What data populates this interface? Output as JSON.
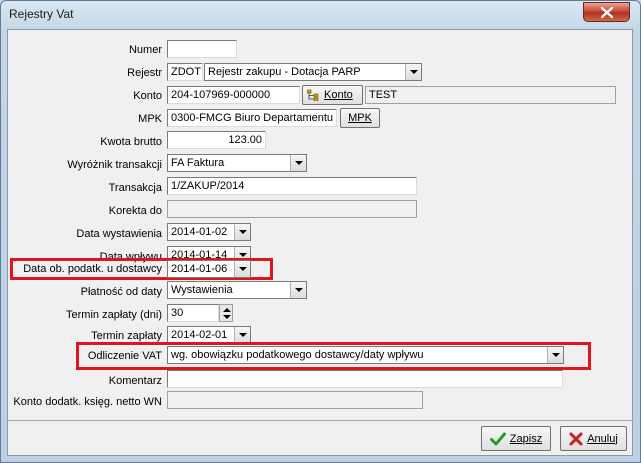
{
  "window": {
    "title": "Rejestry Vat"
  },
  "form": {
    "numer": {
      "label": "Numer",
      "value": ""
    },
    "rejestr": {
      "label": "Rejestr",
      "code": "ZDOT",
      "value": "Rejestr zakupu - Dotacja PARP"
    },
    "konto": {
      "label": "Konto",
      "value": "204-107969-000000",
      "button": "Konto",
      "name": "TEST"
    },
    "mpk": {
      "label": "MPK",
      "value": "0300-FMCG Biuro Departamentu",
      "button": "MPK"
    },
    "kwota_brutto": {
      "label": "Kwota brutto",
      "value": "123.00"
    },
    "wyroznik": {
      "label": "Wyróżnik transakcji",
      "value": "FA Faktura"
    },
    "transakcja": {
      "label": "Transakcja",
      "value": "1/ZAKUP/2014"
    },
    "korekta_do": {
      "label": "Korekta do",
      "value": ""
    },
    "data_wystawienia": {
      "label": "Data wystawienia",
      "value": "2014-01-02"
    },
    "data_wplywu": {
      "label": "Data wpływu",
      "value": "2014-01-14"
    },
    "data_ob_podatk": {
      "label": "Data ob. podatk. u dostawcy",
      "value": "2014-01-06"
    },
    "platnosc_od_daty": {
      "label": "Płatność od daty",
      "value": "Wystawienia"
    },
    "termin_zaplaty_dni": {
      "label": "Termin zapłaty (dni)",
      "value": "30"
    },
    "termin_zaplaty": {
      "label": "Termin zapłaty",
      "value": "2014-02-01"
    },
    "odliczenie_vat": {
      "label": "Odliczenie VAT",
      "value": "wg. obowiązku podatkowego dostawcy/daty wpływu"
    },
    "komentarz": {
      "label": "Komentarz",
      "value": ""
    },
    "konto_dodatk": {
      "label": "Konto dodatk. księg. netto WN",
      "value": ""
    }
  },
  "buttons": {
    "save": "Zapisz",
    "cancel": "Anuluj"
  },
  "colors": {
    "highlight": "#e0141e",
    "save_icon": "#2a9a2a",
    "cancel_icon": "#c81e1e"
  }
}
